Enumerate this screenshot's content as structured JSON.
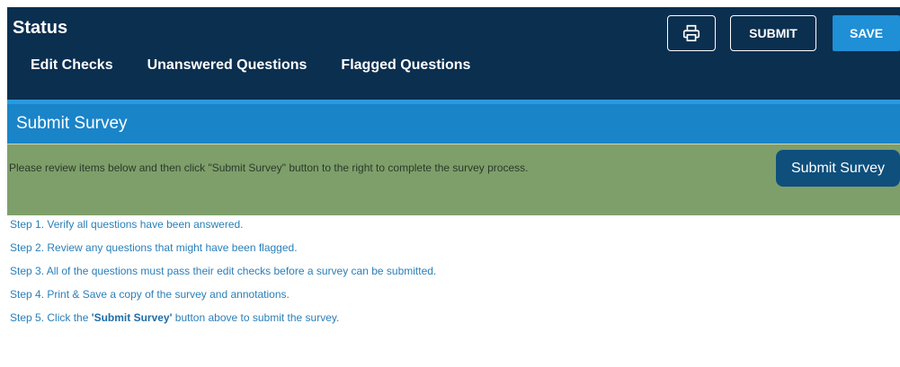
{
  "header": {
    "title": "Status",
    "nav": [
      {
        "label": "Edit Checks"
      },
      {
        "label": "Unanswered Questions"
      },
      {
        "label": "Flagged Questions"
      }
    ],
    "buttons": {
      "print_icon": "printer-icon",
      "submit_label": "SUBMIT",
      "save_label": "SAVE"
    }
  },
  "panel": {
    "title": "Submit Survey",
    "notice_text": "Please review items below and then click \"Submit Survey\" button to the right to complete the survey process.",
    "submit_button_label": "Submit Survey"
  },
  "steps": [
    {
      "text": "Step 1. Verify all questions have been answered."
    },
    {
      "text": "Step 2. Review any questions that might have been flagged."
    },
    {
      "text": "Step 3. All of the questions must pass their edit checks before a survey can be submitted."
    },
    {
      "text": "Step 4. Print & Save a copy of the survey and annotations."
    },
    {
      "prefix": "Step 5. Click the ",
      "emphasis": "'Submit Survey'",
      "suffix": " button above to submit the survey."
    }
  ],
  "colors": {
    "topbar": "#0b2f4f",
    "save_button": "#1f8fd6",
    "panel_header": "#1a84c8",
    "notice_bg": "#7e9f6a",
    "submit_survey_button": "#0f4f7c",
    "step_text": "#2a7fb9"
  }
}
